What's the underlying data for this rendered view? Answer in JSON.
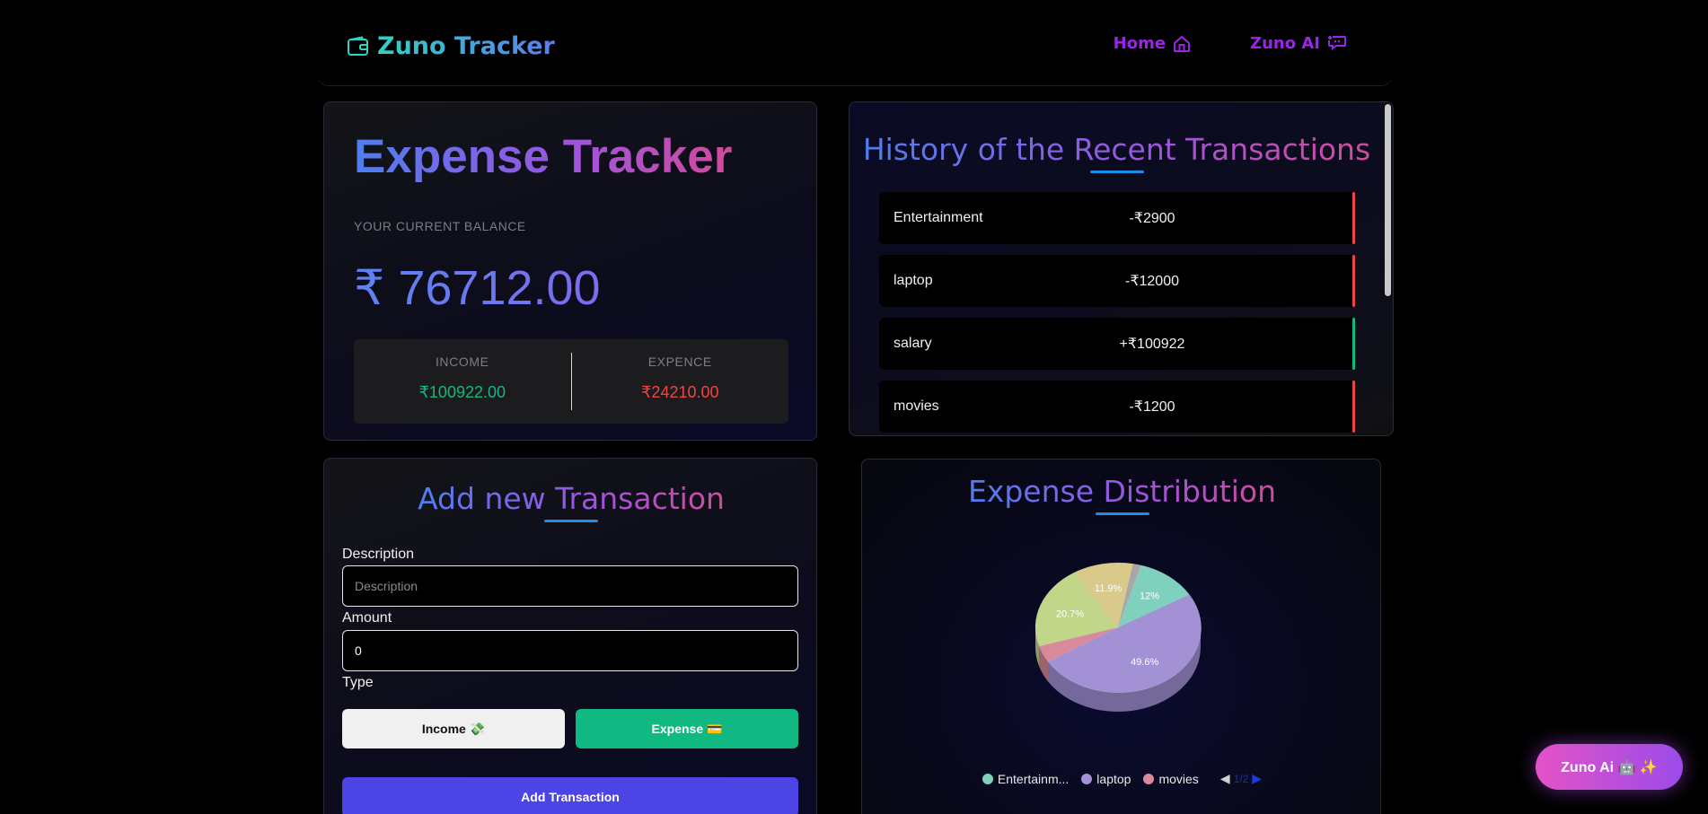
{
  "header": {
    "logo_text": "Zuno Tracker",
    "nav": [
      {
        "label": "Home",
        "icon": "home-icon"
      },
      {
        "label": "Zuno AI",
        "icon": "chat-icon"
      }
    ]
  },
  "balance": {
    "title": "Expense Tracker",
    "label": "YOUR CURRENT BALANCE",
    "amount": "₹ 76712.00",
    "income_label": "INCOME",
    "income_value": "₹100922.00",
    "expense_label": "EXPENCE",
    "expense_value": "₹24210.00"
  },
  "history": {
    "title": "History of the Recent Transactions",
    "items": [
      {
        "desc": "Entertainment",
        "amount": "-₹2900",
        "kind": "expense"
      },
      {
        "desc": "laptop",
        "amount": "-₹12000",
        "kind": "expense"
      },
      {
        "desc": "salary",
        "amount": "+₹100922",
        "kind": "income"
      },
      {
        "desc": "movies",
        "amount": "-₹1200",
        "kind": "expense"
      }
    ]
  },
  "add": {
    "title": "Add new Transaction",
    "description_label": "Description",
    "description_placeholder": "Description",
    "amount_label": "Amount",
    "amount_value": "0",
    "type_label": "Type",
    "income_button": "Income 💸",
    "expense_button": "Expense 💳",
    "submit_button": "Add Transaction"
  },
  "distribution": {
    "title": "Expense Distribution",
    "legend": [
      {
        "label": "Entertainm...",
        "color": "#7fd1be"
      },
      {
        "label": "laptop",
        "color": "#a391d6"
      },
      {
        "label": "movies",
        "color": "#d98a9a"
      }
    ],
    "pager": "1/2"
  },
  "chart_data": {
    "type": "pie",
    "slices": [
      {
        "label": "49.6%",
        "value": 49.6,
        "color": "#a391d6"
      },
      {
        "label": "",
        "value": 4.2,
        "color": "#d98a9a"
      },
      {
        "label": "20.7%",
        "value": 20.7,
        "color": "#c2d68a"
      },
      {
        "label": "11.9%",
        "value": 11.9,
        "color": "#d9c98a"
      },
      {
        "label": "",
        "value": 1.6,
        "color": "#a8a8a8"
      },
      {
        "label": "12%",
        "value": 12.0,
        "color": "#7fd1be"
      }
    ]
  },
  "fab": {
    "label": "Zuno Ai 🤖 ✨"
  },
  "colors": {
    "income": "#10b981",
    "expense": "#ef4444",
    "accent": "#9b24e8",
    "primary_button": "#4c44e4"
  }
}
